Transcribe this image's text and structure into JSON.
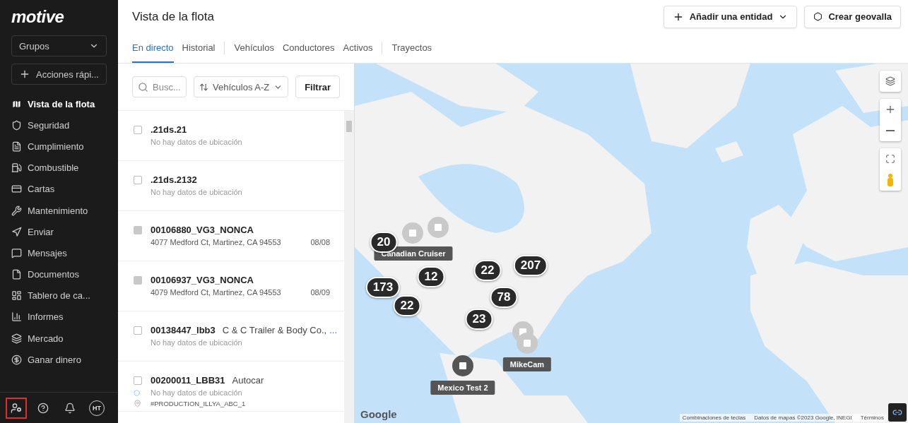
{
  "sidebar": {
    "logo": "motive",
    "groups_select": "Grupos",
    "quick_actions": "Acciones rápi...",
    "nav": [
      {
        "label": "Vista de la flota",
        "selected": true
      },
      {
        "label": "Seguridad",
        "selected": false
      },
      {
        "label": "Cumplimiento",
        "selected": false
      },
      {
        "label": "Combustible",
        "selected": false
      },
      {
        "label": "Cartas",
        "selected": false
      },
      {
        "label": "Mantenimiento",
        "selected": false
      },
      {
        "label": "Enviar",
        "selected": false
      },
      {
        "label": "Mensajes",
        "selected": false
      },
      {
        "label": "Documentos",
        "selected": false
      },
      {
        "label": "Tablero de ca...",
        "selected": false
      },
      {
        "label": "Informes",
        "selected": false
      },
      {
        "label": "Mercado",
        "selected": false
      },
      {
        "label": "Ganar dinero",
        "selected": false
      }
    ],
    "footer": [
      {
        "kind": "admin",
        "highlighted": true
      },
      {
        "kind": "help",
        "highlighted": false
      },
      {
        "kind": "bell",
        "highlighted": false
      },
      {
        "kind": "avatar",
        "label": "HT",
        "highlighted": false
      }
    ]
  },
  "header": {
    "title": "Vista de la flota",
    "buttons": [
      {
        "kind": "add",
        "label": "Añadir una entidad"
      },
      {
        "kind": "geofence",
        "label": "Crear geovalla"
      }
    ],
    "tabs": [
      {
        "label": "En directo",
        "selected": true,
        "divider_before": false
      },
      {
        "label": "Historial",
        "selected": false,
        "divider_before": false
      },
      {
        "label": "Vehículos",
        "selected": false,
        "divider_before": true
      },
      {
        "label": "Conductores",
        "selected": false,
        "divider_before": false
      },
      {
        "label": "Activos",
        "selected": false,
        "divider_before": false
      },
      {
        "label": "Trayectos",
        "selected": false,
        "divider_before": true
      }
    ]
  },
  "list": {
    "search": {
      "placeholder": "Busc..."
    },
    "sort": "Vehículos A-Z",
    "filter": "Filtrar",
    "vehicles": [
      {
        "kind": "checkbox",
        "name": ".21ds.21",
        "location": "No hay datos de ubicación"
      },
      {
        "kind": "checkbox",
        "name": ".21ds.2132",
        "location": "No hay datos de ubicación"
      },
      {
        "kind": "square",
        "name": "00106880_VG3_NONCA",
        "address": "4077 Medford Ct, Martinez, CA 94553",
        "date": "08/08"
      },
      {
        "kind": "square",
        "name": "00106937_VG3_NONCA",
        "address": "4079 Medford Ct, Martinez, CA 94553",
        "date": "08/09"
      },
      {
        "kind": "checkbox",
        "name": "00138447_lbb3",
        "tag": "C & C Trailer & Body Co.,",
        "more": "...",
        "location": "No hay datos de ubicación"
      },
      {
        "kind": "checkbox",
        "name": "00200011_LBB31",
        "tag": "Autocar",
        "location": "No hay datos de ubicación",
        "trip": "#PRODUCTION_ILLYA_ABC_1"
      }
    ]
  },
  "map": {
    "kind": "picture",
    "clusters": [
      "20",
      "12",
      "22",
      "207",
      "173",
      "78",
      "22",
      "23"
    ],
    "pins": [
      {
        "kind": "faded"
      },
      {
        "kind": "faded"
      },
      {
        "kind": "faded"
      },
      {
        "kind": "faded"
      },
      {
        "kind": "dark",
        "label": "Mexico Test 2"
      }
    ],
    "labels": [
      "Canadian Cruiser",
      "MikeCam"
    ],
    "logo": "Google",
    "attribution": [
      "Combinaciones de teclas",
      "Datos de mapas ©2023 Google, INEGI",
      "Términos"
    ]
  }
}
